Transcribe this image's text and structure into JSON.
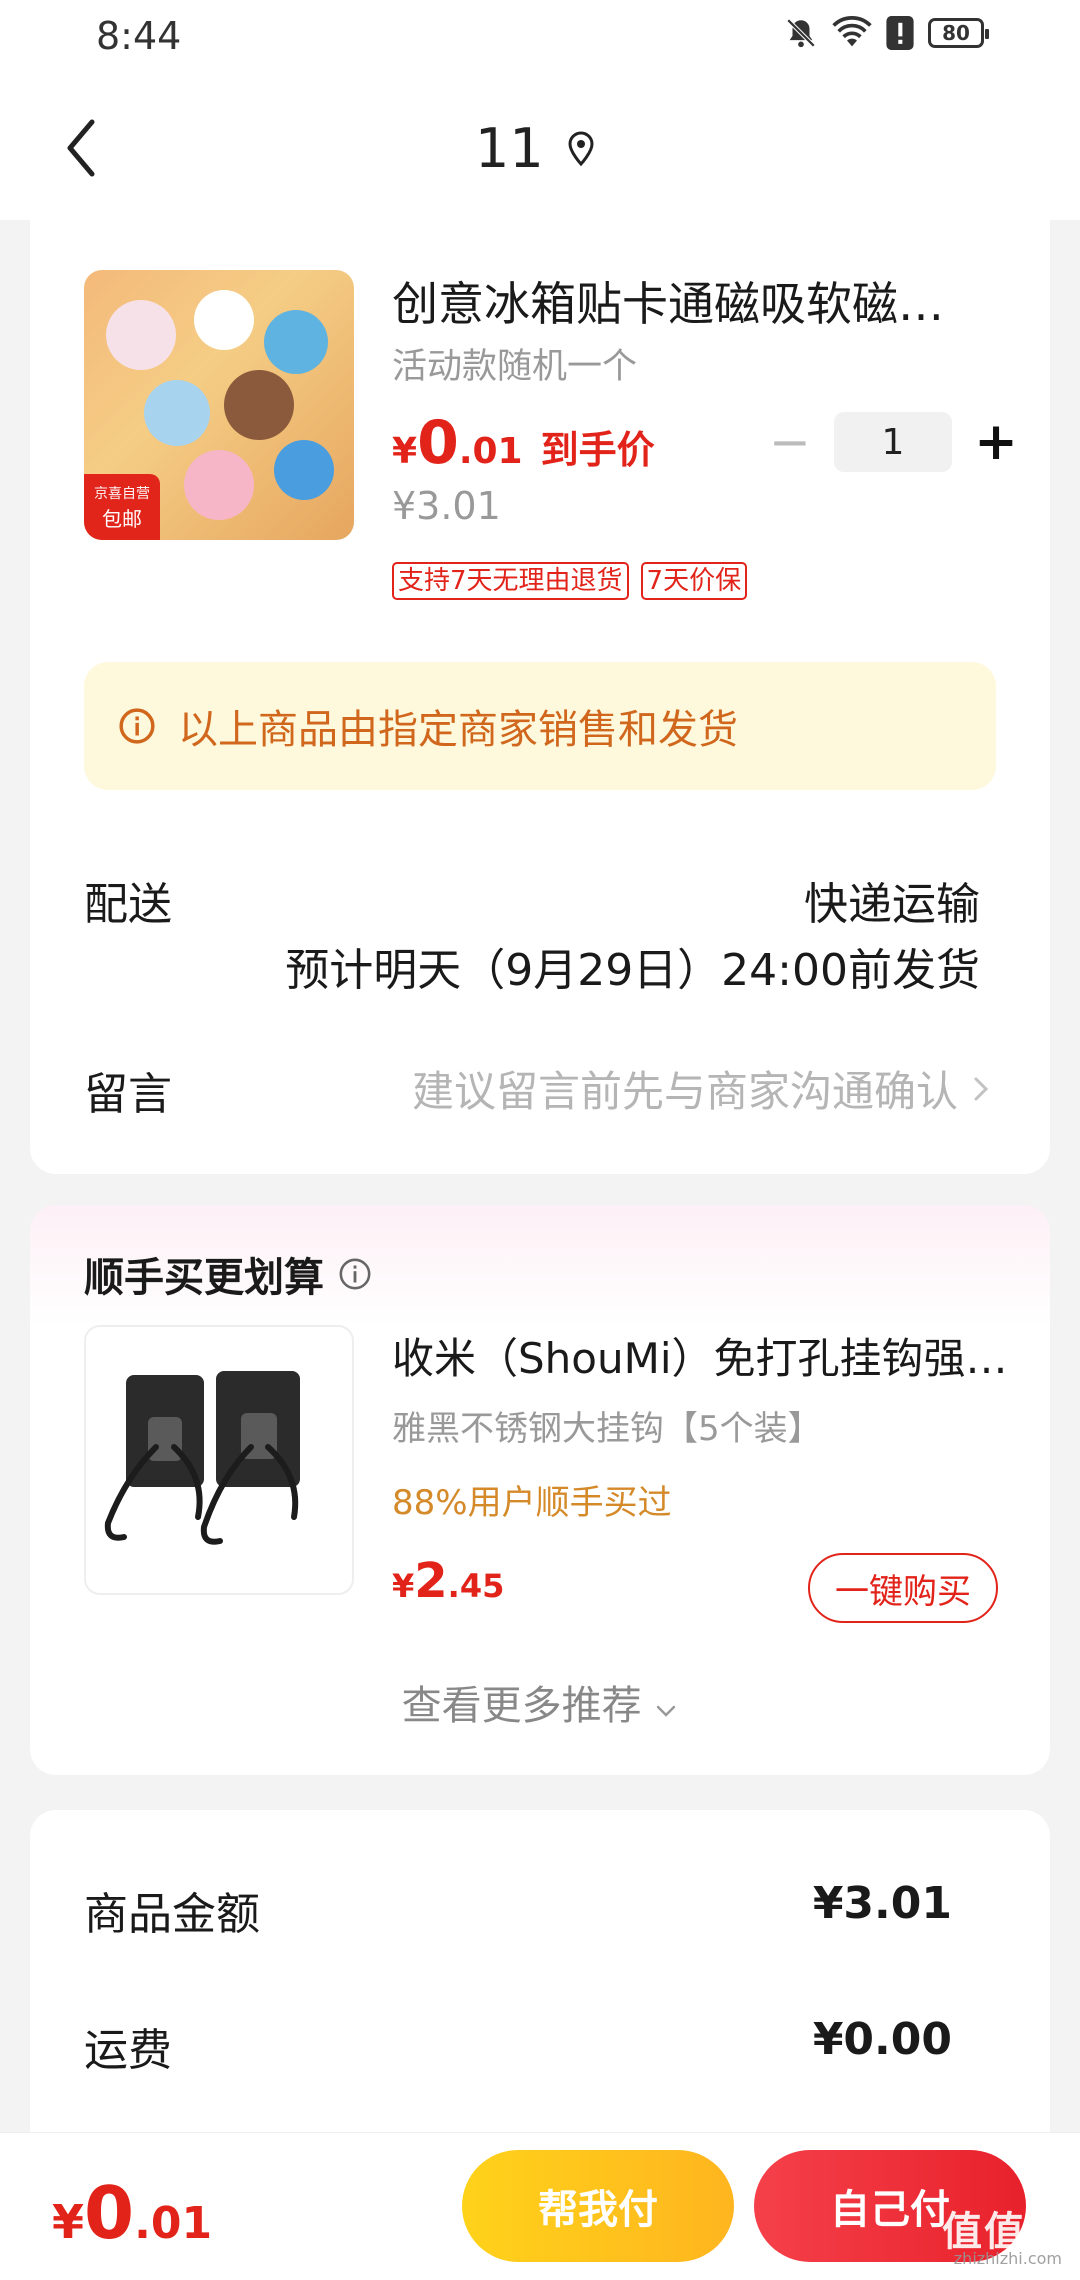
{
  "status_bar": {
    "time": "8:44",
    "battery": "80"
  },
  "nav": {
    "title": "11"
  },
  "product": {
    "title": "创意冰箱贴卡通磁吸软磁…",
    "spec": "活动款随机一个",
    "thumb_tag_top": "京喜自营",
    "thumb_tag_bottom": "包邮",
    "price_yen": "¥",
    "price_int": "0",
    "price_dec": ".01",
    "price_tag": "到手价",
    "original_price": "¥3.01",
    "quantity": "1",
    "quantity_minus": "−",
    "quantity_plus": "+",
    "badges": [
      "支持7天无理由退货",
      "7天价保"
    ]
  },
  "notice": {
    "text": "以上商品由指定商家销售和发货"
  },
  "delivery": {
    "label": "配送",
    "method": "快递运输",
    "eta": "预计明天（9月29日）24:00前发货"
  },
  "message": {
    "label": "留言",
    "placeholder": "建议留言前先与商家沟通确认"
  },
  "recommend": {
    "title": "顺手买更划算",
    "item": {
      "title": "收米（ShouMi）免打孔挂钩强…",
      "spec": "雅黑不锈钢大挂钩【5个装】",
      "bought": "88%用户顺手买过",
      "price_yen": "¥",
      "price_int": "2",
      "price_dec": ".45",
      "buy_label": "一键购买"
    },
    "more_label": "查看更多推荐"
  },
  "summary": {
    "rows": [
      {
        "label": "商品金额",
        "value": "¥3.01"
      },
      {
        "label": "运费",
        "value": "¥0.00"
      }
    ]
  },
  "bottom_bar": {
    "total_yen": "¥",
    "total_int": "0",
    "total_dec": ".01",
    "help_pay": "帮我付",
    "self_pay": "自己付",
    "watermark": "值值值",
    "watermark_sub": "zhizhizhi.com"
  },
  "colors": {
    "accent_red": "#e2231a",
    "notice_bg": "#fef9dc",
    "notice_text": "#d0671d",
    "help_pay": "#ffc21c"
  }
}
